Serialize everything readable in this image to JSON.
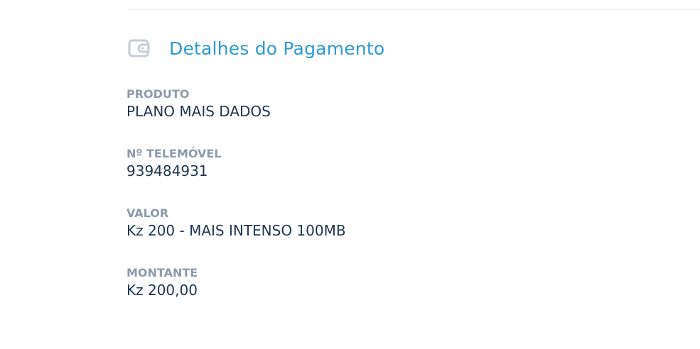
{
  "section": {
    "icon": "wallet-icon",
    "title": "Detalhes do Pagamento"
  },
  "fields": [
    {
      "label": "PRODUTO",
      "value": "PLANO MAIS DADOS"
    },
    {
      "label": "Nº TELEMÓVEL",
      "value": "939484931"
    },
    {
      "label": "VALOR",
      "value": "Kz 200 - MAIS INTENSO 100MB"
    },
    {
      "label": "MONTANTE",
      "value": "Kz 200,00"
    }
  ],
  "colors": {
    "title": "#2a9bd3",
    "label": "#8d9aaa",
    "value": "#1f3550",
    "icon": "#c5ccd4",
    "divider": "#eef0f3"
  }
}
